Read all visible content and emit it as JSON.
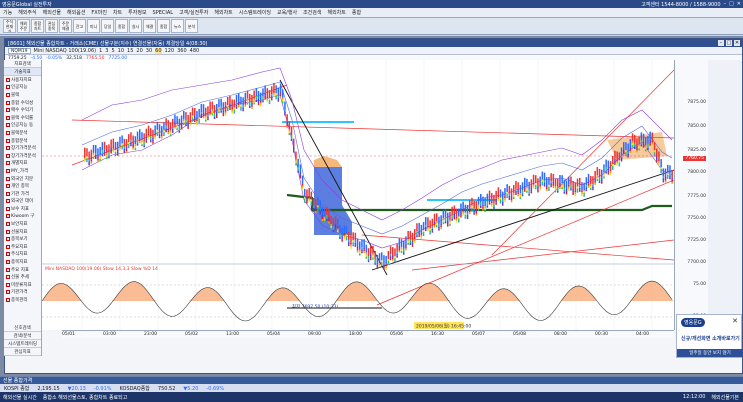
{
  "window": {
    "title": "영웅문Global 실전투자",
    "right_info": "고객센터 1544-8000 / 1588-9000"
  },
  "menu": [
    "기능",
    "해외주식",
    "해외선물",
    "해외옵션",
    "FX마진",
    "차트",
    "투자정보",
    "SPECIAL",
    "고객/실전투자",
    "해외차트",
    "시스템트레이딩",
    "교육/행사",
    "조건검색",
    "해외차트",
    "종합"
  ],
  "toolbar": [
    "주식 현재가",
    "해외 주문",
    "종합 차트",
    "관심 종목",
    "주문 체결",
    "잔고",
    "미니",
    "당일",
    "종합",
    "실시",
    "체결",
    "종합",
    "뉴스",
    "분석"
  ],
  "chart": {
    "window_title": "[8601] 해외선물 종합차트 - 거래소(CME) 선물구분(지수) 연결선물(자동) 체결당일 4(08:30)",
    "symbol": "NQM19",
    "symbol_name": "Mini NASDAQ 100(19.06)",
    "intervals": [
      "1",
      "3",
      "5",
      "10",
      "15",
      "20",
      "30",
      "60",
      "120",
      "360",
      "480"
    ],
    "selected_interval": "60",
    "info": {
      "price": "7759.25",
      "change": "-4.50",
      "rate": "-0.05%",
      "volume": "32,518",
      "high": "7765.50",
      "low": "7725.00"
    },
    "indicator_label": "Mini NASDAQ 100(19.06) Stow 14,3,3 Slow %D 14",
    "crosshair_label": "최저 7697.50 (10:33)",
    "price_levels": [
      "7875.00",
      "7850.00",
      "7825.00",
      "7800.00",
      "7775.00",
      "7750.00",
      "7725.00",
      "7700.00",
      "7675.00"
    ],
    "current_price_tag": "7760.75",
    "osc_levels": [
      "75.00",
      "25.00"
    ],
    "time_labels": [
      "05/01",
      "03:00",
      "23:00",
      "05/02",
      "13:00",
      "05/04",
      "09:00",
      "18:00",
      "05/06",
      "16:30",
      "05/07",
      "05/08",
      "08:00",
      "00:30",
      "04:00"
    ],
    "highlight_time": "2019/05/06(월) 16:45:00"
  },
  "sidebar": {
    "tabs": [
      "지표검색",
      "기술지표"
    ],
    "items": [
      "사용자지표",
      "인공지능",
      "블랙",
      "종합 수익성",
      "매수 수익기",
      "블랙 수익률",
      "인공지능 동",
      "블랙분석",
      "종합분석",
      "장기가격분석",
      "장기가격분석",
      "개별지표",
      "MY_가격",
      "외국인 지분",
      "개인 종목",
      "기관 가격",
      "외국인 데이",
      "보수 지표",
      "Kiwoom 구",
      "보안지표",
      "선물지표",
      "종목보기",
      "주요지표",
      "주식지표",
      "종목지표",
      "주요 지표",
      "선물 추세",
      "미분류지표",
      "기관가격",
      "종목관리",
      "옵션전략",
      "MY 가격",
      "MY_관심종목",
      "선택 주문",
      "주요 사항"
    ],
    "bottom": [
      "신호검색",
      "검색/분석",
      "시스템트레이딩",
      "관심지표"
    ]
  },
  "ad": {
    "badge": "영웅문G",
    "text": "신규/개선화면 소개바로가기",
    "footer": "일주일 동안 보지 않기"
  },
  "mini": {
    "title": "선물 종합가격",
    "rows": [
      "KOSPI 종합",
      "2,195.15",
      "▼20.13",
      "-0.91%",
      "KOSDAQ종합",
      "750.52",
      "▼5.20",
      "-0.69%"
    ]
  },
  "status": {
    "left": "해외선물 실시간",
    "center": "종합소 해외선물스토, 종합차트 종료되고",
    "time": "12:12:00",
    "right": "해외선물기본"
  },
  "colors": {
    "title_bar": "#2b4a8a",
    "bull": "#e33333",
    "bear": "#2b6cff",
    "ichimoku": "#1f5a1f"
  }
}
